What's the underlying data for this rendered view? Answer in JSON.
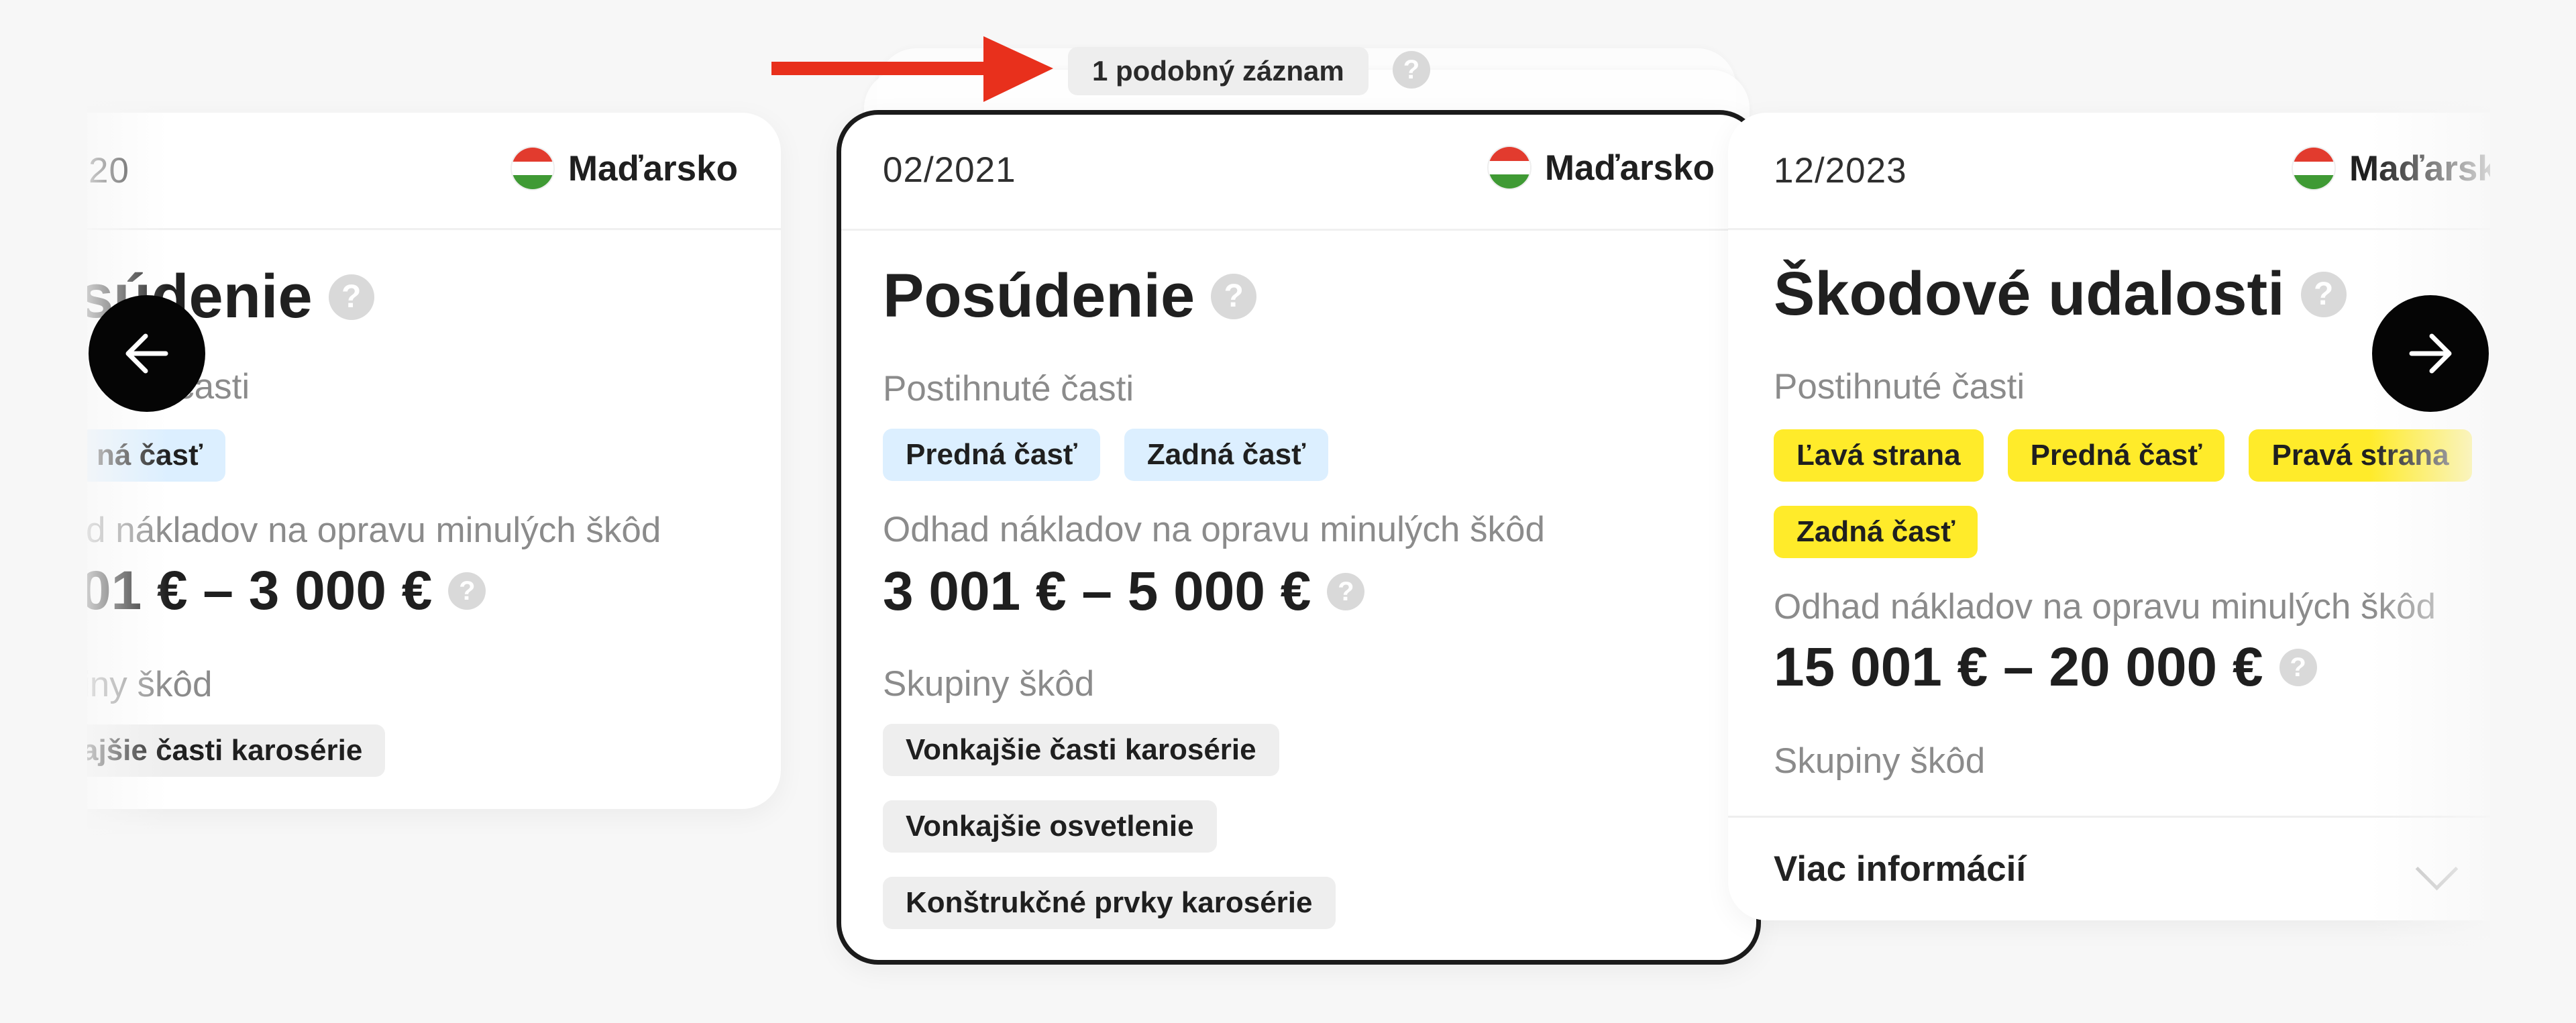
{
  "similar_badge": {
    "text": "1 podobný záznam"
  },
  "common": {
    "affected_label": "Postihnuté časti",
    "estimate_label": "Odhad nákladov na opravu minulých škôd",
    "groups_label": "Skupiny škôd",
    "help_symbol": "?"
  },
  "cards": [
    {
      "date": "20",
      "country": "Maďarsko",
      "title": "súdenie",
      "affected_label": "ené časti",
      "affected_tags": [
        "ná časť"
      ],
      "estimate_label": "d nákladov na opravu minulých škôd",
      "amount": "01 € – 3 000 €",
      "groups_label": "iny škôd",
      "group_tags": [
        "ajšie časti karosérie"
      ]
    },
    {
      "date": "02/2021",
      "country": "Maďarsko",
      "title": "Posúdenie",
      "affected_tags": [
        "Predná časť",
        "Zadná časť"
      ],
      "amount": "3 001 € – 5 000 €",
      "group_tags": [
        "Vonkajšie časti karosérie",
        "Vonkajšie osvetlenie",
        "Konštrukčné prvky karosérie"
      ]
    },
    {
      "date": "12/2023",
      "country": "Maďarsko",
      "title": "Škodové udalosti",
      "affected_tags": [
        "Ľavá strana",
        "Predná časť",
        "Pravá strana",
        "Zadná časť"
      ],
      "amount": "15 001 € – 20 000 €",
      "more_label": "Viac informácií"
    }
  ],
  "colors": {
    "tag_blue": "#dcefff",
    "tag_yellow": "#ffeb2a",
    "tag_gray": "#eeeeee",
    "annotation_arrow": "#e8301c",
    "nav_button": "#050505"
  },
  "icons": {
    "prev": "arrow-left-icon",
    "next": "arrow-right-icon",
    "flag": "hungary-flag-icon",
    "help": "question-circle-icon",
    "expand": "chevron-down-icon"
  }
}
